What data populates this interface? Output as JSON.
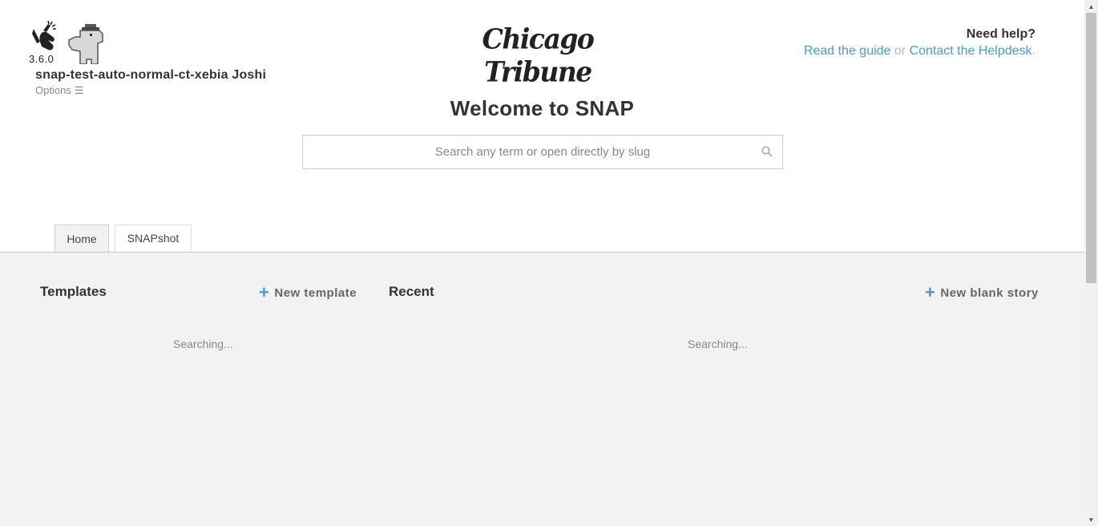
{
  "header": {
    "version": "3.6.0",
    "username": "snap-test-auto-normal-ct-xebia Joshi",
    "options_label": "Options",
    "options_icon": "☰",
    "masthead": "Chicago Tribune",
    "help_title": "Need help?",
    "help_guide": "Read the guide",
    "help_or": " or ",
    "help_desk": "Contact the Helpdesk",
    "help_period": "."
  },
  "main": {
    "welcome": "Welcome to SNAP",
    "search_placeholder": "Search any term or open directly by slug",
    "tabs": [
      {
        "label": "Home"
      },
      {
        "label": "SNAPshot"
      }
    ]
  },
  "templates": {
    "title": "Templates",
    "action": "New template",
    "status": "Searching..."
  },
  "recent": {
    "title": "Recent",
    "action": "New blank story",
    "status": "Searching..."
  },
  "colors": {
    "accent": "#4a9bc8",
    "panel": "#f2f2f2"
  },
  "icons": {
    "logo": "snap-hand-icon",
    "avatar": "dino-avatar-icon",
    "search": "search-icon",
    "plus": "plus-icon"
  }
}
